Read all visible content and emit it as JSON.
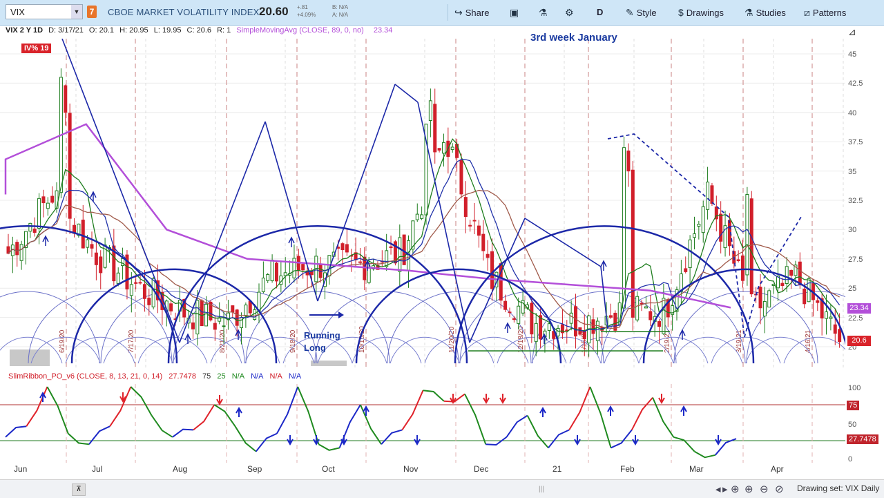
{
  "toolbar": {
    "symbol": "VIX",
    "badge": "7",
    "description": "CBOE MARKET VOLATILITY INDEX",
    "last": "20.60",
    "change": "+.81",
    "change_pct": "+4.09%",
    "bid": "B: N/A",
    "ask": "A: N/A",
    "share_label": "Share",
    "period_label": "D",
    "style_label": "Style",
    "drawings_label": "Drawings",
    "studies_label": "Studies",
    "patterns_label": "Patterns"
  },
  "info": {
    "symbol_period": "VIX 2 Y 1D",
    "date": "D: 3/17/21",
    "open": "O: 20.1",
    "high": "H: 20.95",
    "low": "L: 19.95",
    "close": "C: 20.6",
    "range": "R: 1",
    "sma_label": "SimpleMovingAvg (CLOSE, 89, 0, no)",
    "sma_value": "23.34"
  },
  "iv_badge": "IV% 19",
  "annotation_top": "3rd week January",
  "annotation_running": "Running",
  "annotation_long": "Long",
  "price_axis": {
    "ticks": [
      "45",
      "42.5",
      "40",
      "37.5",
      "35",
      "32.5",
      "30",
      "27.5",
      "25",
      "22.5",
      "20"
    ],
    "sma_tag": "23.34",
    "last_tag": "20.6",
    "sma_tag_color": "#b34fd9",
    "last_tag_color": "#d9232a"
  },
  "vertical_date_labels": [
    "6/19/20",
    "7/17/20",
    "8/21/20",
    "9/18/20",
    "10/16/20",
    "11/20/20",
    "12/18/20",
    "1/15/21",
    "2/19/21",
    "3/19/21",
    "4/16/21"
  ],
  "lower": {
    "title": "SlimRibbon_PO_v6 (CLOSE, 8, 13, 21, 0, 14)",
    "value": "27.7478",
    "p1": "75",
    "p2": "25",
    "n1": "N/A",
    "n2": "N/A",
    "n3": "N/A",
    "n4": "N/A",
    "ticks": [
      "100",
      "50",
      "0"
    ],
    "tag75": "75",
    "tag_value": "27.7478"
  },
  "months": [
    "Jun",
    "Jul",
    "Aug",
    "Sep",
    "Oct",
    "Nov",
    "Dec",
    "21",
    "Feb",
    "Mar",
    "Apr"
  ],
  "bottom": {
    "drawing_set": "Drawing set: VIX Daily"
  },
  "colors": {
    "up": "#1e7d1e",
    "down": "#d11f2a",
    "sma89": "#b34fd9",
    "cycle": "#1c28a8",
    "osc_red": "#e0222a",
    "osc_green": "#1f8a1f",
    "osc_blue": "#1c28c8"
  },
  "chart_data": [
    {
      "type": "line",
      "series": [
        {
          "name": "VIX close",
          "x": [
            "Jun",
            "Jun",
            "Jul",
            "Jul",
            "Aug",
            "Aug",
            "Sep",
            "Sep",
            "Oct",
            "Oct",
            "Nov",
            "Nov",
            "Dec",
            "Dec",
            "Jan",
            "Jan",
            "Feb",
            "Feb",
            "Mar",
            "Mar"
          ],
          "values": [
            28,
            33,
            28,
            25,
            23,
            22,
            26,
            27,
            27,
            28,
            38,
            26,
            22,
            22,
            23,
            23,
            33,
            23,
            26,
            20.6
          ]
        },
        {
          "name": "SimpleMovingAvg (CLOSE, 89, 0, no)",
          "x": [
            "Jun",
            "Jul",
            "Aug",
            "Sep",
            "Oct",
            "Nov",
            "Dec",
            "Jan",
            "Feb",
            "Mar"
          ],
          "values": [
            36,
            39,
            30,
            27.5,
            27,
            26.5,
            25.8,
            25.3,
            24.8,
            23.34
          ]
        }
      ],
      "ylim": [
        19,
        46
      ]
    },
    {
      "type": "line",
      "title": "SlimRibbon_PO_v6 (CLOSE, 8, 13, 21, 0, 14)",
      "series": [
        {
          "name": "SlimRibbon_PO_v6",
          "values": [
            30,
            45,
            100,
            35,
            20,
            45,
            100,
            60,
            30,
            40,
            75,
            45,
            10,
            35,
            100,
            20,
            15,
            75,
            20,
            40,
            95,
            80,
            90,
            20,
            30,
            60,
            15,
            40,
            100,
            15,
            40,
            85,
            30,
            10,
            5,
            27.7478
          ]
        }
      ],
      "ylim": [
        0,
        100
      ],
      "reference_lines": [
        75,
        25
      ]
    }
  ]
}
